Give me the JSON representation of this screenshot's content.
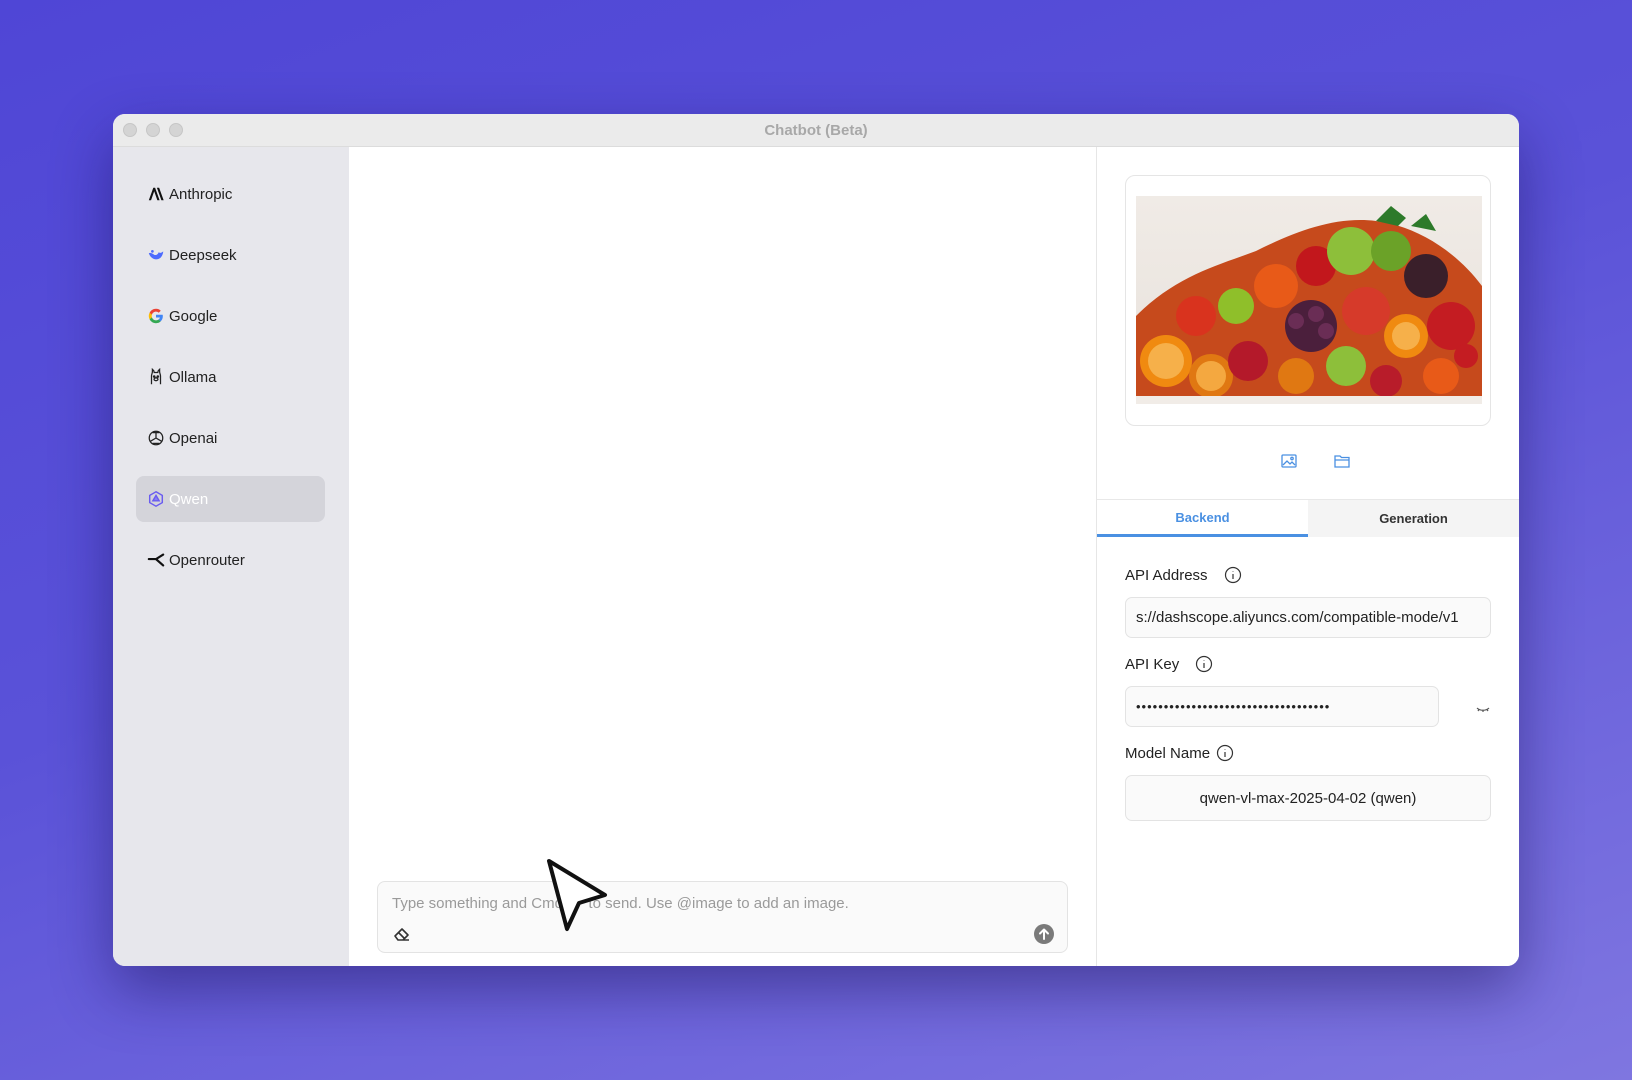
{
  "window": {
    "title": "Chatbot (Beta)"
  },
  "sidebar": {
    "items": [
      {
        "label": "Anthropic",
        "icon": "anthropic-icon",
        "active": false
      },
      {
        "label": "Deepseek",
        "icon": "deepseek-icon",
        "active": false
      },
      {
        "label": "Google",
        "icon": "google-icon",
        "active": false
      },
      {
        "label": "Ollama",
        "icon": "ollama-icon",
        "active": false
      },
      {
        "label": "Openai",
        "icon": "openai-icon",
        "active": true
      },
      {
        "label": "Qwen",
        "icon": "qwen-icon",
        "active": true
      },
      {
        "label": "Openrouter",
        "icon": "openrouter-icon",
        "active": false
      }
    ]
  },
  "composer": {
    "placeholder": "Type something and Cmd+↵ to send. Use @image to add an image.",
    "eraser_icon": "eraser-icon",
    "send_icon": "send-arrow-icon"
  },
  "panel": {
    "image_buttons": [
      "image-icon",
      "folder-icon"
    ],
    "tabs": [
      {
        "label": "Backend",
        "active": true
      },
      {
        "label": "Generation",
        "active": false
      }
    ],
    "api_address": {
      "label": "API Address",
      "value": "s://dashscope.aliyuncs.com/compatible-mode/v1"
    },
    "api_key": {
      "label": "API Key",
      "value": "•••••••••••••••••••••••••••••••••••"
    },
    "model_name": {
      "label": "Model Name",
      "value": "qwen-vl-max-2025-04-02 (qwen)"
    }
  },
  "colors": {
    "accent": "#4a90e2",
    "background": "#5a52d8"
  }
}
